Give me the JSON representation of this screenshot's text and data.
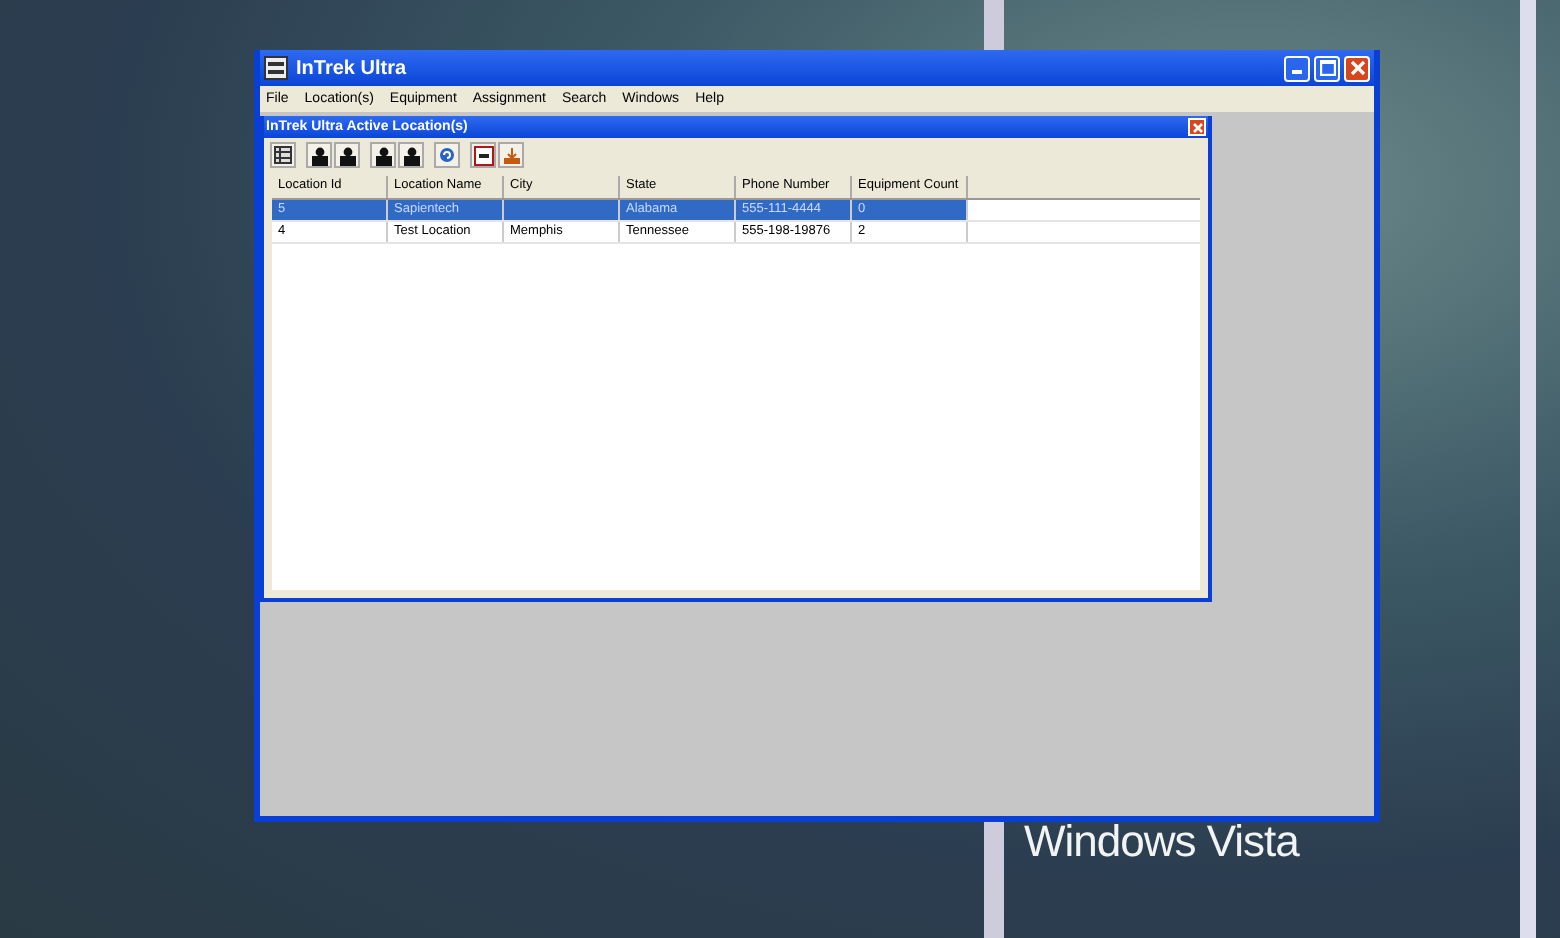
{
  "window": {
    "title": "InTrek Ultra"
  },
  "menu": [
    "File",
    "Location(s)",
    "Equipment",
    "Assignment",
    "Search",
    "Windows",
    "Help"
  ],
  "child_window": {
    "title": "InTrek Ultra Active Location(s)",
    "table": {
      "columns": [
        "Location Id",
        "Location Name",
        "City",
        "State",
        "Phone Number",
        "Equipment Count"
      ],
      "rows": [
        {
          "cells": [
            "5",
            "Sapientech",
            "",
            "Alabama",
            "555-111-4444",
            "0"
          ],
          "selected": true
        },
        {
          "cells": [
            "4",
            "Test Location",
            "Memphis",
            "Tennessee",
            "555-198-19876",
            "2"
          ],
          "selected": false
        }
      ]
    }
  },
  "desktop": {
    "branding": "Windows Vista"
  }
}
